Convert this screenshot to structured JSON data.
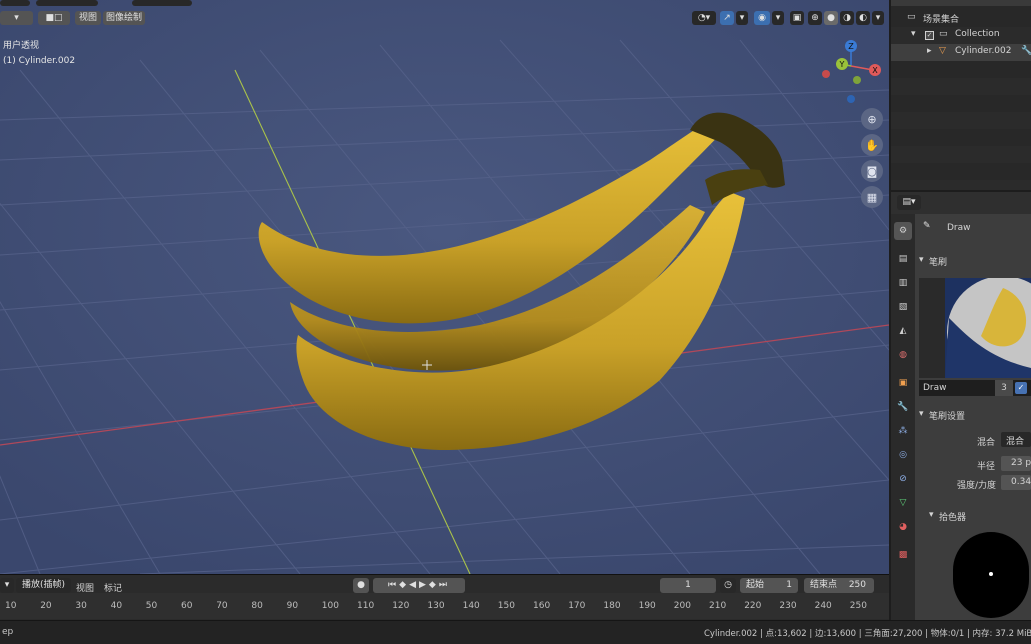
{
  "header": {
    "mode_left": "Draw",
    "view_menu": "视图",
    "image_paint_menu": "图像绘制"
  },
  "viewport": {
    "perspective_label": "用户透视",
    "object_label": "(1) Cylinder.002",
    "background_color": "#3d4b73",
    "axis_x_color": "#e05a5a",
    "axis_y_color": "#9ac23a",
    "axis_z_color": "#3a7bd5",
    "gizmo_labels": [
      "Z",
      "Y",
      "X"
    ]
  },
  "timeline": {
    "playback_menu": "播放(插帧)",
    "view_menu": "视图",
    "marker_menu": "标记",
    "current_frame": "1",
    "start_label": "起始",
    "start_value": "1",
    "end_label": "结束点",
    "end_value": "250",
    "ruler": [
      "10",
      "20",
      "30",
      "40",
      "50",
      "60",
      "70",
      "80",
      "90",
      "100",
      "110",
      "120",
      "130",
      "140",
      "150",
      "160",
      "170",
      "180",
      "190",
      "200",
      "210",
      "220",
      "230",
      "240",
      "250"
    ]
  },
  "statusbar": {
    "left_text": "ep",
    "info": "Cylinder.002 | 点:13,602 | 边:13,600 | 三角面:27,200 | 物体:0/1 | 内存: 37.2 MiB | v"
  },
  "outliner": {
    "scene_collection": "场景集合",
    "collection": "Collection",
    "object": "Cylinder.002"
  },
  "properties": {
    "brush_name_header": "Draw",
    "brush_panel": "笔刷",
    "brush_field_name": "Draw",
    "brush_users": "3",
    "brush_settings_panel": "笔刷设置",
    "blend_label": "混合",
    "blend_value": "混合",
    "radius_label": "半径",
    "radius_value": "23 p",
    "strength_label": "强度/力度",
    "strength_value": "0.34",
    "color_picker_panel": "拾色器"
  }
}
